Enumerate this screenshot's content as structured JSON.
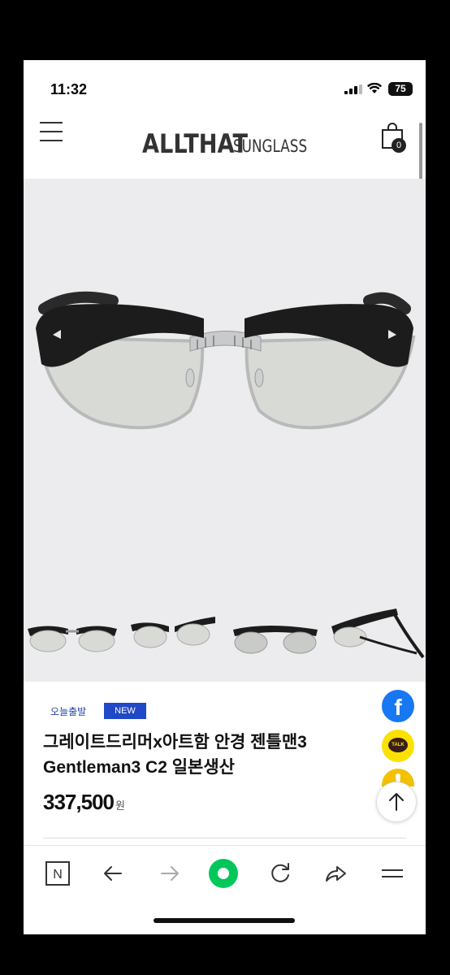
{
  "status_bar": {
    "time": "11:32",
    "battery": "75"
  },
  "header": {
    "logo_main": "ALLTHAT",
    "logo_sub": "SUNGLASS",
    "cart_count": "0"
  },
  "product": {
    "tag_today": "오늘출발",
    "tag_new": "NEW",
    "name_line1": "그레이트드리머x아트함 안경 젠틀맨3",
    "name_line2": "Gentleman3 C2 일본생산",
    "price": "337,500",
    "currency": "원"
  },
  "floating_buttons": {
    "facebook": "f",
    "kakaotalk": "TALK"
  },
  "toolbar": {
    "n_label": "N"
  },
  "icons": [
    "menu-icon",
    "cart-icon",
    "facebook-icon",
    "kakaotalk-icon",
    "kakaostory-icon",
    "arrow-up-icon",
    "n-home-icon",
    "back-arrow-icon",
    "forward-arrow-icon",
    "green-dot-icon",
    "refresh-icon",
    "share-icon",
    "hamburger-icon"
  ],
  "colors": {
    "brand_text": "#333333",
    "new_tag": "#2048c8",
    "facebook": "#1877f2",
    "kakao": "#fae100",
    "naver_green": "#03c75a"
  }
}
